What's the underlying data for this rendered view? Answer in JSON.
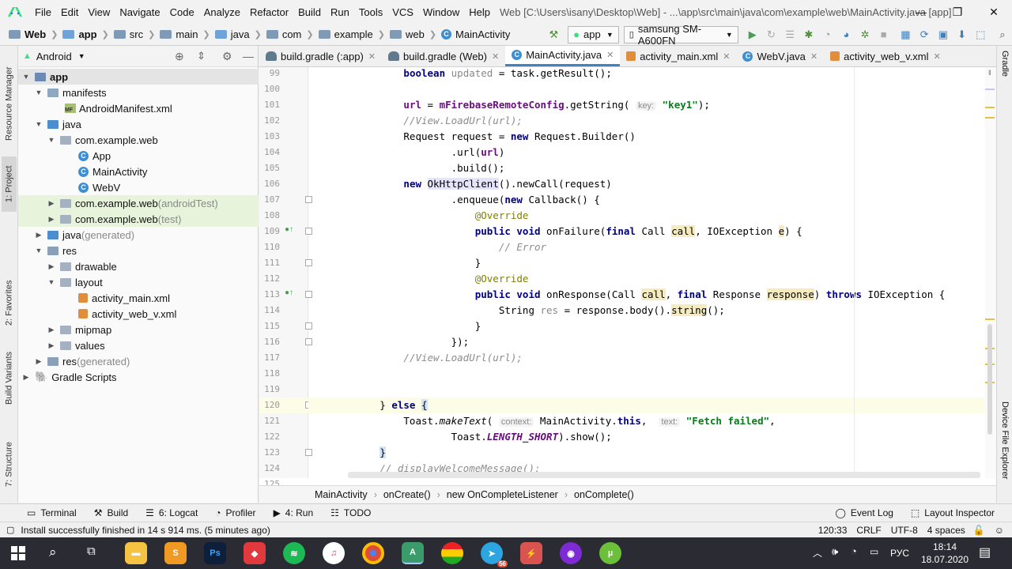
{
  "menubar": {
    "items": [
      "File",
      "Edit",
      "View",
      "Navigate",
      "Code",
      "Analyze",
      "Refactor",
      "Build",
      "Run",
      "Tools",
      "VCS",
      "Window",
      "Help"
    ],
    "window_title": "Web [C:\\Users\\isany\\Desktop\\Web] - ...\\app\\src\\main\\java\\com\\example\\web\\MainActivity.java [app]"
  },
  "toolbar": {
    "crumbs": [
      "Web",
      "app",
      "src",
      "main",
      "java",
      "com",
      "example",
      "web",
      "MainActivity"
    ],
    "config": "app",
    "device": "samsung SM-A600FN"
  },
  "project": {
    "view_label": "Android",
    "tree": [
      {
        "label": "app",
        "suffix": ""
      },
      {
        "label": "manifests",
        "suffix": ""
      },
      {
        "label": "AndroidManifest.xml",
        "suffix": ""
      },
      {
        "label": "java",
        "suffix": ""
      },
      {
        "label": "com.example.web",
        "suffix": ""
      },
      {
        "label": "App",
        "suffix": ""
      },
      {
        "label": "MainActivity",
        "suffix": ""
      },
      {
        "label": "WebV",
        "suffix": ""
      },
      {
        "label": "com.example.web",
        "suffix": " (androidTest)"
      },
      {
        "label": "com.example.web",
        "suffix": " (test)"
      },
      {
        "label": "java",
        "suffix": " (generated)"
      },
      {
        "label": "res",
        "suffix": ""
      },
      {
        "label": "drawable",
        "suffix": ""
      },
      {
        "label": "layout",
        "suffix": ""
      },
      {
        "label": "activity_main.xml",
        "suffix": ""
      },
      {
        "label": "activity_web_v.xml",
        "suffix": ""
      },
      {
        "label": "mipmap",
        "suffix": ""
      },
      {
        "label": "values",
        "suffix": ""
      },
      {
        "label": "res",
        "suffix": " (generated)"
      },
      {
        "label": "Gradle Scripts",
        "suffix": ""
      }
    ]
  },
  "left_tabs": [
    "Resource Manager",
    "1: Project",
    "2: Favorites",
    "Build Variants",
    "7: Structure"
  ],
  "right_tabs": [
    "Gradle",
    "Device File Explorer"
  ],
  "editor": {
    "tabs": [
      "build.gradle (:app)",
      "build.gradle (Web)",
      "MainActivity.java",
      "activity_main.xml",
      "WebV.java",
      "activity_web_v.xml"
    ],
    "active_tab": 2,
    "line_numbers": [
      "99",
      "100",
      "101",
      "102",
      "103",
      "104",
      "105",
      "106",
      "107",
      "108",
      "109",
      "110",
      "111",
      "112",
      "113",
      "114",
      "115",
      "116",
      "117",
      "118",
      "119",
      "120",
      "121",
      "122",
      "123",
      "124",
      "125"
    ]
  },
  "code_breadcrumb": [
    "MainActivity",
    "onCreate()",
    "new OnCompleteListener",
    "onComplete()"
  ],
  "toolwindows": {
    "left": [
      "Terminal",
      "Build",
      "6: Logcat",
      "Profiler",
      "4: Run",
      "TODO"
    ],
    "right": [
      "Event Log",
      "Layout Inspector"
    ]
  },
  "status": {
    "message": "Install successfully finished in 14 s 914 ms. (5 minutes ago)",
    "position": "120:33",
    "line_sep": "CRLF",
    "encoding": "UTF-8",
    "indent": "4 spaces"
  },
  "taskbar": {
    "lang": "РУС",
    "time": "18:14",
    "date": "18.07.2020",
    "telegram_badge": "56"
  }
}
